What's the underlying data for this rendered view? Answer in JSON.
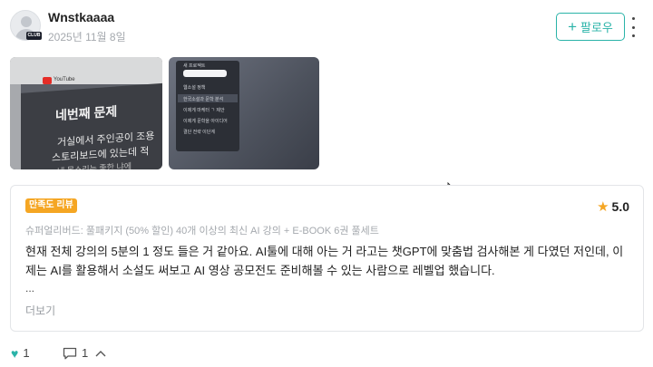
{
  "author": {
    "name": "Wnstkaaaa",
    "date": "2025년 11월 8일",
    "badge": "CLUB"
  },
  "follow_button": {
    "label": "팔로우",
    "icon": "plus-icon",
    "accent_color": "#2ab3a8"
  },
  "photos": [
    {
      "title": "네번째 문제",
      "line1": "거실에서 주인공이 조용",
      "line2": "스토리보드에 있는데 적",
      "line3": "내 목소리는 좋한 냐에",
      "brand": "YouTube"
    },
    {
      "menu_header": "새 프로젝트",
      "menu_items": [
        "웹소설 정책",
        "한국소설과 문학 분석",
        "이제게 마케터 ㄱ 제안",
        "이제게 문학을 아이디어",
        "결단 전략 이단계"
      ]
    }
  ],
  "review": {
    "badge": "만족도 리뷰",
    "badge_color": "#f5a623",
    "score": "5.0",
    "product": "슈퍼얼리버드: 풀패키지 (50% 할인) 40개 이상의 최신 AI 강의 + E-BOOK 6권 풀세트",
    "text": "현재 전체 강의의 5분의 1 정도 들은 거 같아요. AI툴에 대해 아는 거 라고는 챗GPT에 맞춤법 검사해본 게 다였던 저인데, 이제는 AI를 활용해서 소설도 써보고 AI 영상 공모전도 준비해볼 수 있는 사람으로 레벨업 했습니다.",
    "ellipsis": "...",
    "more_label": "더보기"
  },
  "footer": {
    "likes": "1",
    "comments": "1"
  }
}
